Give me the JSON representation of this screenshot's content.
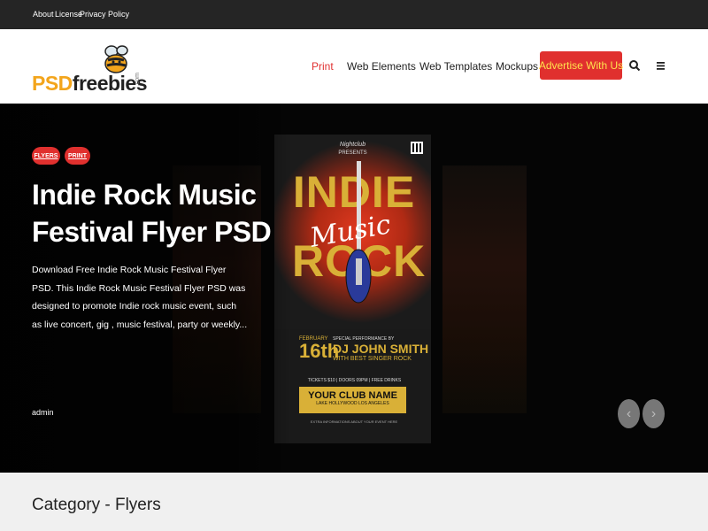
{
  "topbar": {
    "links": [
      "About",
      "License",
      "Privacy Policy"
    ]
  },
  "logo": {
    "part1": "PSD",
    "part2": "freebies",
    "suffix": ".com"
  },
  "nav": {
    "items": [
      "Print",
      "Web Elements",
      "Web Templates",
      "Mockups"
    ],
    "advertise": "Advertise With Us",
    "active_color": "#e03030",
    "accent": "#e0302e"
  },
  "hero": {
    "tags": [
      "FLYERS",
      "PRINT"
    ],
    "title": "Indie Rock Music Festival Flyer PSD",
    "description": "Download Free Indie Rock Music Festival Flyer PSD. This Indie Rock Music Festival Flyer PSD was designed to promote Indie rock music event, such as live concert, gig , music festival, party or weekly...",
    "author": "admin",
    "prev_icon": "chevron-left-icon",
    "next_icon": "chevron-right-icon"
  },
  "flyer": {
    "top_small": "Nightclub",
    "top_sub": "PRESENTS",
    "indie": "INDIE",
    "music": "Music",
    "rock": "ROCK",
    "month": "FEBRUARY",
    "day": "16th",
    "special": "SPECIAL PERFORMANCE BY",
    "dj": "DJ JOHN SMITH",
    "with": "WITH BEST SINGER ROCK",
    "info": "TICKETS $10 | DOORS 09PM | FREE DRINKS",
    "club": "YOUR CLUB NAME",
    "address": "LAKE HOLLYWOOD LOS ANGELES",
    "footer": "EXTRA INFORMATIONS ABOUT YOUR EVENT HERE"
  },
  "category": {
    "title": "Category - Flyers"
  }
}
